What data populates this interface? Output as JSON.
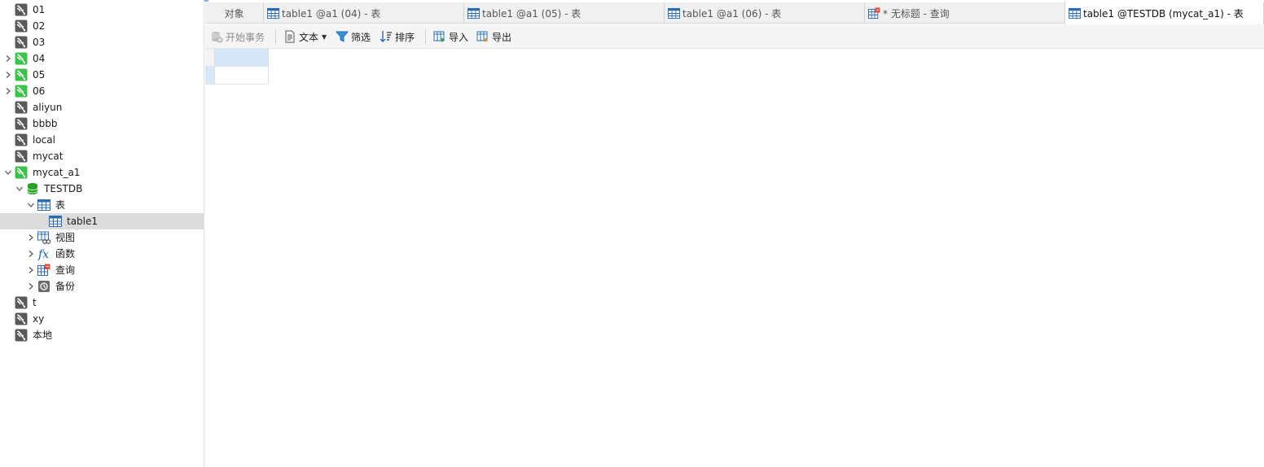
{
  "connections_top": [
    {
      "label": "01",
      "expandable": false,
      "active": false
    },
    {
      "label": "02",
      "expandable": false,
      "active": false
    },
    {
      "label": "03",
      "expandable": false,
      "active": false
    },
    {
      "label": "04",
      "expandable": true,
      "active": true
    },
    {
      "label": "05",
      "expandable": true,
      "active": true
    },
    {
      "label": "06",
      "expandable": true,
      "active": true
    },
    {
      "label": "aliyun",
      "expandable": false,
      "active": false
    },
    {
      "label": "bbbb",
      "expandable": false,
      "active": false
    },
    {
      "label": "local",
      "expandable": false,
      "active": false
    },
    {
      "label": "mycat",
      "expandable": false,
      "active": false
    }
  ],
  "open_connection": {
    "label": "mycat_a1",
    "database": {
      "label": "TESTDB",
      "tables_group": {
        "label": "表",
        "items": [
          {
            "label": "table1"
          }
        ]
      },
      "groups": [
        {
          "label": "视图",
          "icon": "view-icon"
        },
        {
          "label": "函数",
          "icon": "function-icon"
        },
        {
          "label": "查询",
          "icon": "query-icon"
        },
        {
          "label": "备份",
          "icon": "backup-icon"
        }
      ]
    }
  },
  "connections_bottom": [
    {
      "label": "t"
    },
    {
      "label": "xy"
    },
    {
      "label": "本地"
    }
  ],
  "tabs": [
    {
      "label": "对象",
      "icon": "",
      "active": false
    },
    {
      "label": "table1 @a1 (04) - 表",
      "icon": "table-icon",
      "active": false
    },
    {
      "label": "table1 @a1 (05) - 表",
      "icon": "table-icon",
      "active": false
    },
    {
      "label": "table1 @a1 (06) - 表",
      "icon": "table-icon",
      "active": false
    },
    {
      "label": "* 无标题 - 查询",
      "icon": "query-icon",
      "active": false
    },
    {
      "label": "table1 @TESTDB (mycat_a1) - 表",
      "icon": "table-icon",
      "active": true
    }
  ],
  "toolbar": {
    "begin_transaction": "开始事务",
    "text": "文本",
    "filter": "筛选",
    "sort": "排序",
    "import": "导入",
    "export": "导出"
  },
  "colors": {
    "connection_active": "#3cc24a",
    "connection_inactive": "#5a5a5a",
    "database": "#2aa22a",
    "table_icon": "#2b6cb0",
    "selection": "#d6e8f7",
    "tree_selected": "#dcdcdc"
  }
}
